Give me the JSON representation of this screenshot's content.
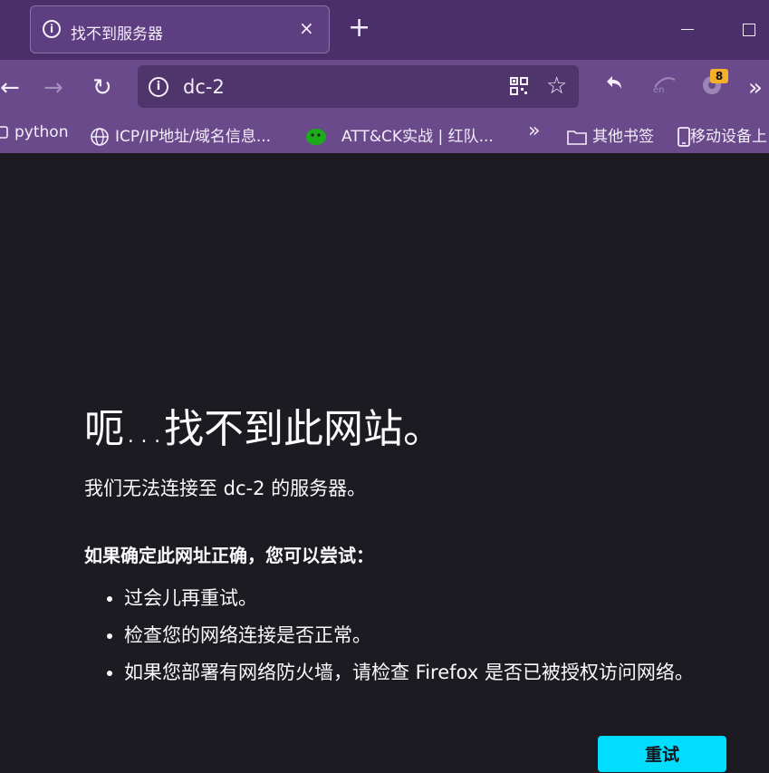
{
  "tab": {
    "title": "找不到服务器",
    "close": "×"
  },
  "newtab": "+",
  "nav": {
    "back": "←",
    "forward": "→",
    "reload": "↻"
  },
  "urlbar": {
    "url": "dc-2",
    "star": "☆"
  },
  "extensions": {
    "badge_count": "8",
    "overflow": "»"
  },
  "bookmarks": {
    "items": [
      {
        "label": "python",
        "icon": "folder-icon"
      },
      {
        "label": "ICP/IP地址/域名信息...",
        "icon": "globe-icon"
      },
      {
        "label": "ATT&CK实战 | 红队...",
        "icon": "wechat-icon"
      },
      {
        "label": "»",
        "icon": "chevron-double-right-icon"
      },
      {
        "label": "其他书签",
        "icon": "folder-icon"
      },
      {
        "label": "移动设备上",
        "icon": "mobile-icon"
      }
    ]
  },
  "error": {
    "title": "呃…找不到此网站。",
    "subtitle": "我们无法连接至 dc-2 的服务器。",
    "try_title": "如果确定此网址正确，您可以尝试：",
    "suggestions": [
      "过会儿再重试。",
      "检查您的网络连接是否正常。",
      "如果您部署有网络防火墙，请检查 Firefox 是否已被授权访问网络。"
    ],
    "retry_label": "重试"
  },
  "colors": {
    "accent": "#00ddff",
    "tabstrip": "#4a2f6a",
    "toolbar": "#6b4a8c",
    "background": "#1c1b22"
  }
}
